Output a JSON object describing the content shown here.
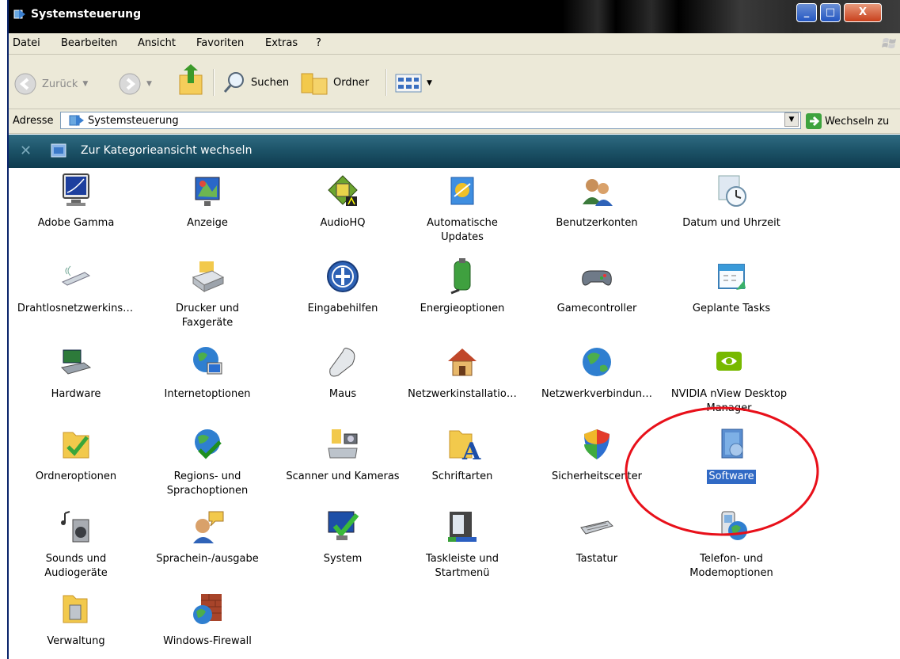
{
  "window": {
    "title": "Systemsteuerung",
    "minimize": "_",
    "maximize": "□",
    "close": "X"
  },
  "menu": [
    "Datei",
    "Bearbeiten",
    "Ansicht",
    "Favoriten",
    "Extras",
    "?"
  ],
  "toolbar": {
    "back_label": "Zurück",
    "search_label": "Suchen",
    "folders_label": "Ordner"
  },
  "address": {
    "label": "Adresse",
    "value": "Systemsteuerung",
    "go_label": "Wechseln zu"
  },
  "category_bar": {
    "text": "Zur Kategorieansicht wechseln"
  },
  "items": [
    {
      "label": "Adobe Gamma",
      "icon": "monitor-icon"
    },
    {
      "label": "Anzeige",
      "icon": "display-icon"
    },
    {
      "label": "AudioHQ",
      "icon": "audio-icon"
    },
    {
      "label": "Automatische Updates",
      "icon": "updates-icon"
    },
    {
      "label": "Benutzerkonten",
      "icon": "users-icon"
    },
    {
      "label": "Datum und Uhrzeit",
      "icon": "clock-icon"
    },
    {
      "label": "Drahtlosnetzwerkins…",
      "icon": "wireless-icon"
    },
    {
      "label": "Drucker und Faxgeräte",
      "icon": "printer-icon"
    },
    {
      "label": "Eingabehilfen",
      "icon": "accessibility-icon"
    },
    {
      "label": "Energieoptionen",
      "icon": "battery-icon"
    },
    {
      "label": "Gamecontroller",
      "icon": "gamepad-icon"
    },
    {
      "label": "Geplante Tasks",
      "icon": "calendar-icon"
    },
    {
      "label": "Hardware",
      "icon": "hardware-icon"
    },
    {
      "label": "Internetoptionen",
      "icon": "globe-icon"
    },
    {
      "label": "Maus",
      "icon": "mouse-icon"
    },
    {
      "label": "Netzwerkinstallatio…",
      "icon": "house-icon"
    },
    {
      "label": "Netzwerkverbindun…",
      "icon": "globe-icon"
    },
    {
      "label": "NVIDIA nView Desktop Manager",
      "icon": "nvidia-icon"
    },
    {
      "label": "Ordneroptionen",
      "icon": "folder-check-icon"
    },
    {
      "label": "Regions- und Sprachoptionen",
      "icon": "globe-check-icon"
    },
    {
      "label": "Scanner und Kameras",
      "icon": "scanner-icon"
    },
    {
      "label": "Schriftarten",
      "icon": "fonts-folder-icon"
    },
    {
      "label": "Sicherheitscenter",
      "icon": "shield-icon"
    },
    {
      "label": "Software",
      "icon": "software-icon",
      "selected": true
    },
    {
      "label": "Sounds und Audiogeräte",
      "icon": "speaker-icon"
    },
    {
      "label": "Sprachein-/ausgabe",
      "icon": "speech-icon"
    },
    {
      "label": "System",
      "icon": "system-icon"
    },
    {
      "label": "Taskleiste und Startmenü",
      "icon": "taskbar-icon"
    },
    {
      "label": "Tastatur",
      "icon": "keyboard-icon"
    },
    {
      "label": "Telefon- und Modemoptionen",
      "icon": "phone-icon"
    },
    {
      "label": "Verwaltung",
      "icon": "admin-tools-icon"
    },
    {
      "label": "Windows-Firewall",
      "icon": "firewall-icon"
    }
  ],
  "colors": {
    "selection": "#316ac5",
    "category_bar": "#1d5469",
    "annotation": "#e8101a"
  }
}
